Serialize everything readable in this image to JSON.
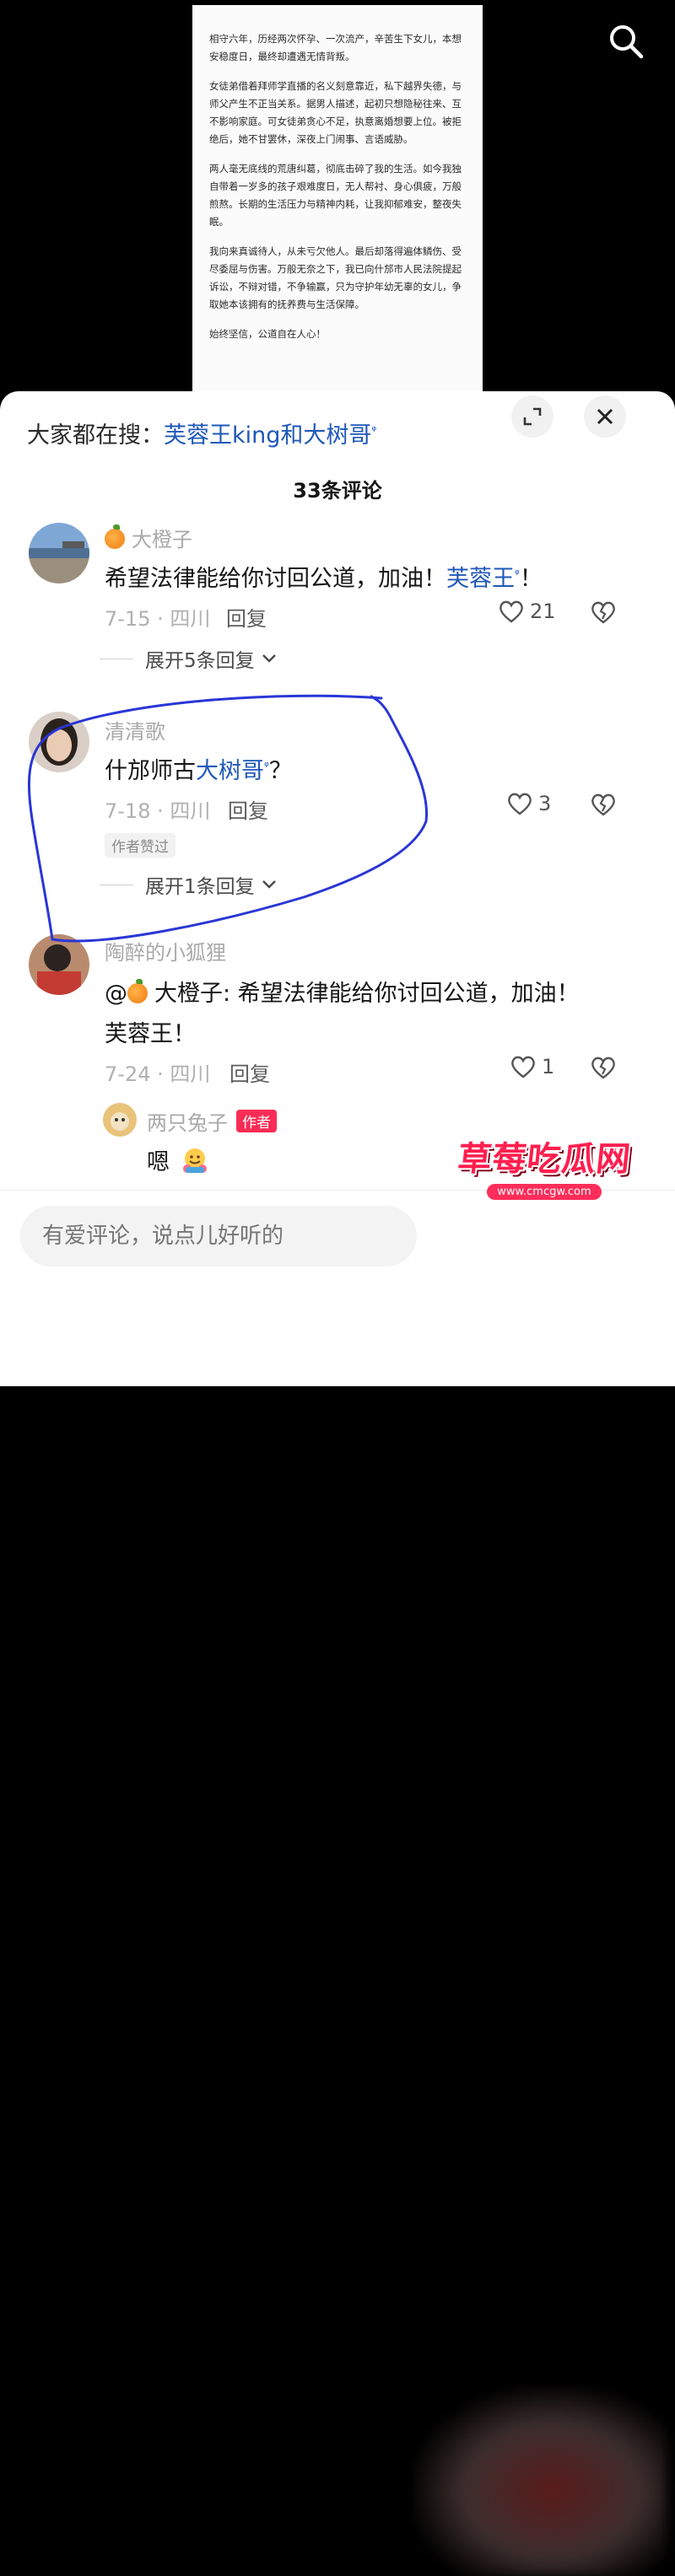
{
  "document_card": {
    "paragraphs": [
      "相守六年，历经两次怀孕、一次流产，辛苦生下女儿，本想安稳度日，最终却遭遇无情背叛。",
      "女徒弟借着拜师学直播的名义刻意靠近，私下越界失德，与师父产生不正当关系。据男人描述，起初只想隐秘往来、互不影响家庭。可女徒弟贪心不足，执意离婚想要上位。被拒绝后，她不甘罢休，深夜上门闹事、言语威胁。",
      "两人毫无底线的荒唐纠葛，彻底击碎了我的生活。如今我独自带着一岁多的孩子艰难度日，无人帮衬、身心俱疲，万般煎熬。长期的生活压力与精神内耗，让我抑郁难安，整夜失眠。",
      "我向来真诚待人，从未亏欠他人。最后却落得遍体鳞伤、受尽委屈与伤害。万般无奈之下，我已向什邡市人民法院提起诉讼，不辩对错，不争输赢，只为守护年幼无辜的女儿，争取她本该拥有的抚养费与生活保障。",
      "始终坚信，公道自在人心！"
    ]
  },
  "header": {
    "hot_prefix": "大家都在搜：",
    "hot_term": "芙蓉王king和大树哥",
    "count_title": "33条评论"
  },
  "comments": [
    {
      "username": "大橙子",
      "text_pre": "希望法律能给你讨回公道，加油！",
      "link": "芙蓉王",
      "text_post": "！",
      "date_loc": "7-15 · 四川",
      "reply_label": "回复",
      "likes": "21",
      "expand": "展开5条回复"
    },
    {
      "username": "清清歌",
      "text_pre": "什邡师古",
      "link": "大树哥",
      "text_post": "？",
      "date_loc": "7-18 · 四川",
      "reply_label": "回复",
      "likes": "3",
      "author_liked": "作者赞过",
      "expand": "展开1条回复"
    },
    {
      "username": "陶醉的小狐狸",
      "line1_mention": "@",
      "line1_rest": "大橙子: 希望法律能给你讨回公道，加油！",
      "line2": "芙蓉王！",
      "date_loc": "7-24 · 四川",
      "reply_label": "回复",
      "likes": "1"
    }
  ],
  "nested_reply": {
    "username": "两只兔子",
    "badge": "作者",
    "text": "嗯"
  },
  "input": {
    "placeholder": "有爱评论，说点儿好听的"
  },
  "watermark": {
    "title": "草莓吃瓜网",
    "url": "www.cmcgw.com"
  },
  "colors": {
    "link_blue": "#1f58b8",
    "annotation_blue": "#2a36d6",
    "author_red": "#fa2c55"
  }
}
